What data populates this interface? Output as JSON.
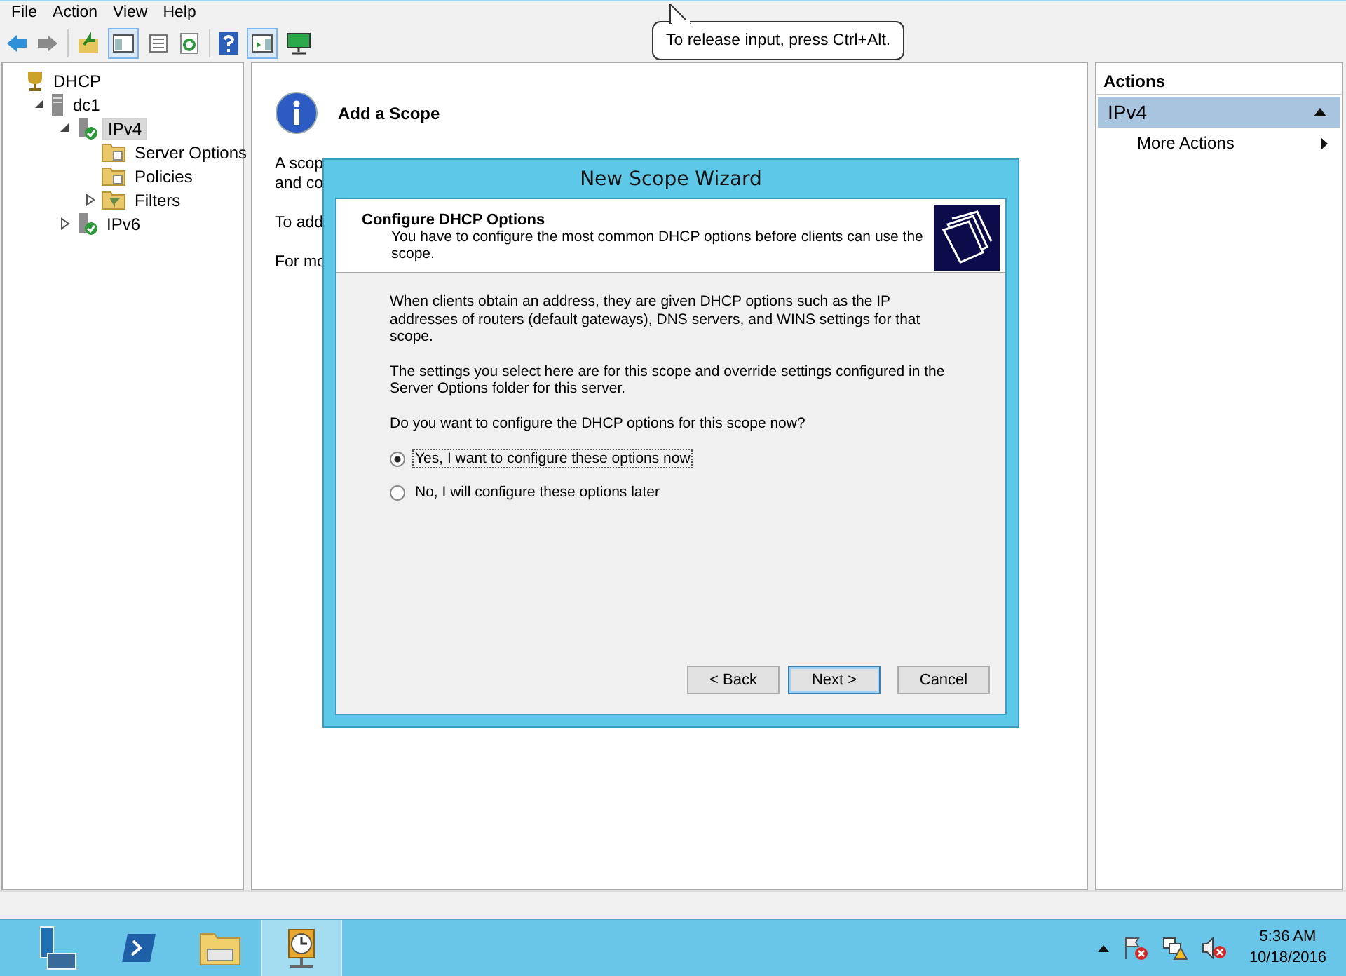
{
  "menu": [
    "File",
    "Action",
    "View",
    "Help"
  ],
  "tree": [
    {
      "label": "DHCP",
      "kind": "dhcp",
      "selected": false,
      "children": [
        {
          "label": "dc1",
          "kind": "server",
          "selected": false,
          "expanded": true,
          "children": [
            {
              "label": "IPv4",
              "kind": "adapter",
              "selected": true,
              "expanded": true,
              "children": [
                {
                  "label": "Server Options",
                  "kind": "folder",
                  "selected": false
                },
                {
                  "label": "Policies",
                  "kind": "folder",
                  "selected": false
                },
                {
                  "label": "Filters",
                  "kind": "filter",
                  "selected": false,
                  "expanded": false
                }
              ]
            },
            {
              "label": "IPv6",
              "kind": "adapter",
              "selected": false,
              "expanded": false
            }
          ]
        }
      ]
    }
  ],
  "content": {
    "heading": "Add a Scope",
    "lines": [
      "A scop",
      "and co",
      "To add",
      "For mo"
    ]
  },
  "dialog": {
    "title": "New Scope Wizard",
    "header_title": "Configure DHCP Options",
    "header_subtitle": "You have to configure the most common DHCP options before clients can use the scope.",
    "paragraphs": [
      "When clients obtain an address, they are given DHCP options such as the IP addresses of routers (default gateways), DNS servers, and WINS settings for that scope.",
      "The settings you select here are for this scope and override settings configured in the Server Options folder for this server."
    ],
    "question": "Do you want to configure the DHCP options for this scope now?",
    "options": [
      {
        "label": "Yes, I want to configure these options now",
        "selected": true
      },
      {
        "label": "No, I will configure these options later",
        "selected": false
      }
    ],
    "buttons": [
      {
        "label": "< Back",
        "default": false
      },
      {
        "label": "Next >",
        "default": true
      },
      {
        "label": "Cancel",
        "default": false
      }
    ]
  },
  "actions": {
    "title": "Actions",
    "section": {
      "label": "IPv4",
      "expanded": true
    },
    "items": [
      {
        "label": "More Actions"
      }
    ]
  },
  "tooltip": "To release input, press Ctrl+Alt.",
  "taskbar": {
    "apps": [
      {
        "kind": "server-manager",
        "selected": false
      },
      {
        "kind": "powershell",
        "selected": false
      },
      {
        "kind": "explorer",
        "selected": false
      },
      {
        "kind": "dhcp",
        "selected": true
      }
    ],
    "time": "5:36 AM",
    "date": "10/18/2016"
  }
}
